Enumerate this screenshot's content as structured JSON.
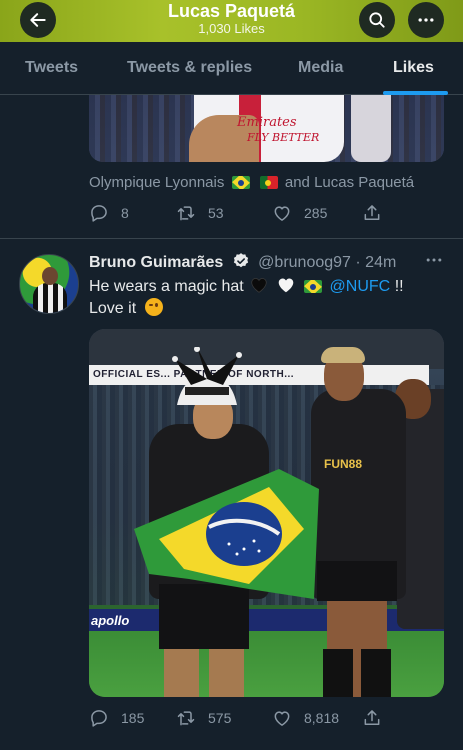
{
  "header": {
    "title": "Lucas Paquetá",
    "subtitle": "1,030 Likes"
  },
  "tabs": [
    {
      "label": "Tweets",
      "active": false
    },
    {
      "label": "Tweets & replies",
      "active": false
    },
    {
      "label": "Media",
      "active": false
    },
    {
      "label": "Likes",
      "active": true
    }
  ],
  "previous_tweet": {
    "media_text_1": "Emirates",
    "media_text_2": "FLY BETTER",
    "caption_left": "Olympique Lyonnais",
    "caption_right": "and Lucas Paquetá",
    "replies": "8",
    "retweets": "53",
    "likes": "285"
  },
  "tweet": {
    "name": "Bruno Guimarães",
    "handle": "@brunoog97",
    "separator": "·",
    "time": "24m",
    "text_1": "He wears a magic hat",
    "mention": "@NUFC",
    "text_2": "!!",
    "text_3": "Love it",
    "photo_banner": "OFFICIAL ES... PARTNER OF NORTH...",
    "photo_board": "apollo",
    "photo_sponsor": "FUN88",
    "replies": "185",
    "retweets": "575",
    "likes": "8,818"
  },
  "colors": {
    "background": "#15202b",
    "accent": "#1d9bf0",
    "header": "#9bb724",
    "muted": "#8b98a5"
  },
  "icons": [
    "back-arrow-icon",
    "search-icon",
    "more-icon",
    "reply-icon",
    "retweet-icon",
    "like-icon",
    "share-icon",
    "verified-icon"
  ]
}
